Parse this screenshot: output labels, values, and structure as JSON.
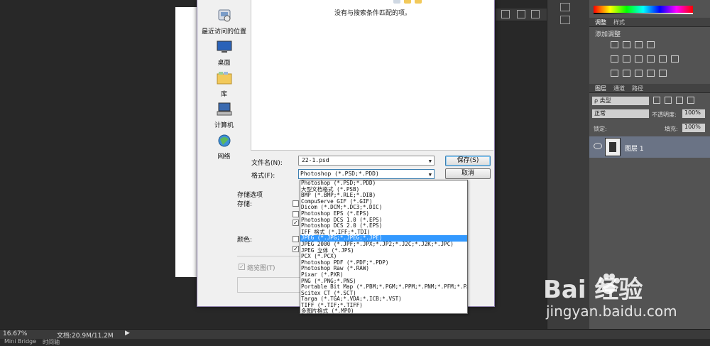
{
  "status": {
    "zoom": "16.67%",
    "doc_info": "文档:20.9M/11.2M",
    "arrow": "▶"
  },
  "bottom_tabs": [
    "Mini Bridge",
    "时间轴"
  ],
  "panels": {
    "top_tabs": [
      "调整",
      "样式"
    ],
    "adjust_title": "添加调整",
    "layer_tabs": [
      "图层",
      "通道",
      "路径"
    ],
    "filter_label": "ρ 类型",
    "blend_mode": "正常",
    "opacity_label": "不透明度:",
    "opacity_value": "100%",
    "lock_label": "锁定:",
    "fill_label": "填充:",
    "fill_value": "100%",
    "layer_name": "图层 1"
  },
  "watermark": {
    "logo": "Bai  经验",
    "url": "jingyan.baidu.com"
  },
  "dialog": {
    "places": [
      {
        "label": "最近访问的位置",
        "icon": "recent-places-icon"
      },
      {
        "label": "桌面",
        "icon": "desktop-icon"
      },
      {
        "label": "库",
        "icon": "libraries-icon"
      },
      {
        "label": "计算机",
        "icon": "computer-icon"
      },
      {
        "label": "网络",
        "icon": "network-icon"
      }
    ],
    "empty_message": "没有与搜索条件匹配的项。",
    "filename_label": "文件名(N):",
    "filename_value": "22-1.psd",
    "format_label": "格式(F):",
    "format_value": "Photoshop (*.PSD;*.PDD)",
    "save_button": "保存(S)",
    "cancel_button": "取消",
    "options_title": "存储选项",
    "store_label": "存储:",
    "color_label": "颜色:",
    "thumbnail_label": "缩览图(T)",
    "format_options": [
      "Photoshop (*.PSD;*.PDD)",
      "大型文档格式 (*.PSB)",
      "BMP (*.BMP;*.RLE;*.DIB)",
      "CompuServe GIF (*.GIF)",
      "Dicom (*.DCM;*.DC3;*.DIC)",
      "Photoshop EPS (*.EPS)",
      "Photoshop DCS 1.0 (*.EPS)",
      "Photoshop DCS 2.0 (*.EPS)",
      "IFF 格式 (*.IFF;*.TDI)",
      "JPEG (*.JPG;*.JPEG;*.JPE)",
      "JPEG 2000 (*.JPF;*.JPX;*.JP2;*.J2C;*.J2K;*.JPC)",
      "JPEG 立体 (*.JPS)",
      "PCX (*.PCX)",
      "Photoshop PDF (*.PDF;*.PDP)",
      "Photoshop Raw (*.RAW)",
      "Pixar (*.PXR)",
      "PNG (*.PNG;*.PNS)",
      "Portable Bit Map (*.PBM;*.PGM;*.PPM;*.PNM;*.PFM;*.PAM)",
      "Scitex CT (*.SCT)",
      "Targa (*.TGA;*.VDA;*.ICB;*.VST)",
      "TIFF (*.TIF;*.TIFF)",
      "多图片格式 (*.MPO)"
    ],
    "selected_format_index": 9,
    "accent_color": "#3399ff"
  }
}
